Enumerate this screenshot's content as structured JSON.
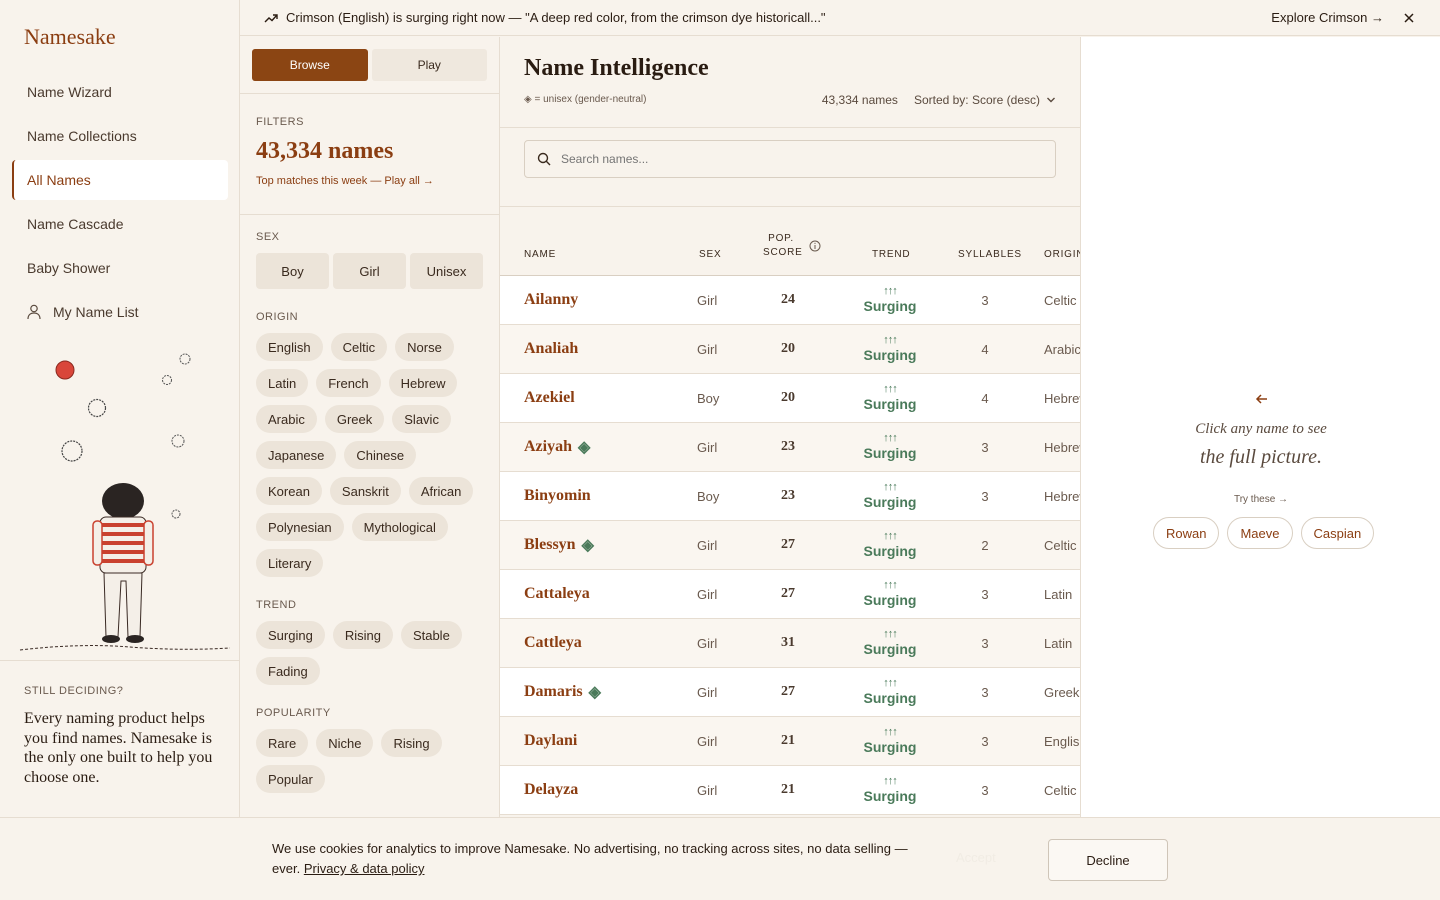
{
  "app": {
    "brand": "Namesake"
  },
  "sidebar": {
    "items": [
      {
        "label": "Name Wizard"
      },
      {
        "label": "Name Collections"
      },
      {
        "label": "All Names",
        "active": true
      },
      {
        "label": "Name Cascade"
      },
      {
        "label": "Baby Shower"
      },
      {
        "label": "My Name List",
        "icon": "person-icon"
      }
    ],
    "deciding": {
      "kicker": "Still deciding?",
      "copy": "Every naming product helps you find names. Namesake is the only one built to help you choose one."
    }
  },
  "banner": {
    "icon": "trending-up-icon",
    "message": "Crimson (English) is surging right now — \"A deep red color, from the crimson dye historicall...\"",
    "explore": "Explore Crimson →"
  },
  "filters": {
    "tabs": [
      {
        "label": "Browse",
        "active": true
      },
      {
        "label": "Play"
      }
    ],
    "label": "Filters",
    "count": "43,334 names",
    "top_matches": "Top matches this week — Play all →",
    "sex": {
      "label": "Sex",
      "options": [
        "Boy",
        "Girl",
        "Unisex"
      ]
    },
    "origin": {
      "label": "Origin",
      "options": [
        "English",
        "Celtic",
        "Norse",
        "Latin",
        "French",
        "Hebrew",
        "Arabic",
        "Greek",
        "Slavic",
        "Japanese",
        "Chinese",
        "Korean",
        "Sanskrit",
        "African",
        "Polynesian",
        "Mythological",
        "Literary"
      ]
    },
    "trend": {
      "label": "Trend",
      "options": [
        "Surging",
        "Rising",
        "Stable",
        "Fading"
      ]
    },
    "popularity": {
      "label": "Popularity",
      "options": [
        "Rare",
        "Niche",
        "Rising",
        "Popular"
      ]
    }
  },
  "main": {
    "title": "Name Intelligence",
    "unisex_note": "◈ = unisex (gender-neutral)",
    "count": "43,334 names",
    "sort": "Sorted by: Score (desc)",
    "search_placeholder": "Search names...",
    "columns": {
      "name": "Name",
      "sex": "Sex",
      "score_top": "Pop.",
      "score_bottom": "Score",
      "trend": "Trend",
      "syllables": "Syllables",
      "origin": "Origin"
    },
    "rows": [
      {
        "name": "Ailanny",
        "unisex": false,
        "sex": "Girl",
        "score": "24",
        "trend_arrows": "↑↑↑",
        "trend": "Surging",
        "syllables": "3",
        "origin": "Celtic"
      },
      {
        "name": "Analiah",
        "unisex": false,
        "sex": "Girl",
        "score": "20",
        "trend_arrows": "↑↑↑",
        "trend": "Surging",
        "syllables": "4",
        "origin": "Arabic"
      },
      {
        "name": "Azekiel",
        "unisex": false,
        "sex": "Boy",
        "score": "20",
        "trend_arrows": "↑↑↑",
        "trend": "Surging",
        "syllables": "4",
        "origin": "Hebrew"
      },
      {
        "name": "Aziyah",
        "unisex": true,
        "sex": "Girl",
        "score": "23",
        "trend_arrows": "↑↑↑",
        "trend": "Surging",
        "syllables": "3",
        "origin": "Hebrew"
      },
      {
        "name": "Binyomin",
        "unisex": false,
        "sex": "Boy",
        "score": "23",
        "trend_arrows": "↑↑↑",
        "trend": "Surging",
        "syllables": "3",
        "origin": "Hebrew"
      },
      {
        "name": "Blessyn",
        "unisex": true,
        "sex": "Girl",
        "score": "27",
        "trend_arrows": "↑↑↑",
        "trend": "Surging",
        "syllables": "2",
        "origin": "Celtic"
      },
      {
        "name": "Cattaleya",
        "unisex": false,
        "sex": "Girl",
        "score": "27",
        "trend_arrows": "↑↑↑",
        "trend": "Surging",
        "syllables": "3",
        "origin": "Latin"
      },
      {
        "name": "Cattleya",
        "unisex": false,
        "sex": "Girl",
        "score": "31",
        "trend_arrows": "↑↑↑",
        "trend": "Surging",
        "syllables": "3",
        "origin": "Latin"
      },
      {
        "name": "Damaris",
        "unisex": true,
        "sex": "Girl",
        "score": "27",
        "trend_arrows": "↑↑↑",
        "trend": "Surging",
        "syllables": "3",
        "origin": "Greek"
      },
      {
        "name": "Daylani",
        "unisex": false,
        "sex": "Girl",
        "score": "21",
        "trend_arrows": "↑↑↑",
        "trend": "Surging",
        "syllables": "3",
        "origin": "English"
      },
      {
        "name": "Delayza",
        "unisex": false,
        "sex": "Girl",
        "score": "21",
        "trend_arrows": "↑↑↑",
        "trend": "Surging",
        "syllables": "3",
        "origin": "Celtic"
      }
    ]
  },
  "detail": {
    "line1": "Click any name to see",
    "line2": "the full picture.",
    "try_label": "Try these →",
    "suggestions": [
      "Rowan",
      "Maeve",
      "Caspian"
    ]
  },
  "cookie": {
    "text": "We use cookies for analytics to improve Namesake. No advertising, no tracking across sites, no data selling — ever.",
    "link": "Privacy & data policy",
    "accept": "Accept",
    "decline": "Decline"
  },
  "colors": {
    "accent": "#8b3e12",
    "button": "#8b4513",
    "trend_green": "#4a7a5a",
    "background": "#f8f3ec"
  }
}
